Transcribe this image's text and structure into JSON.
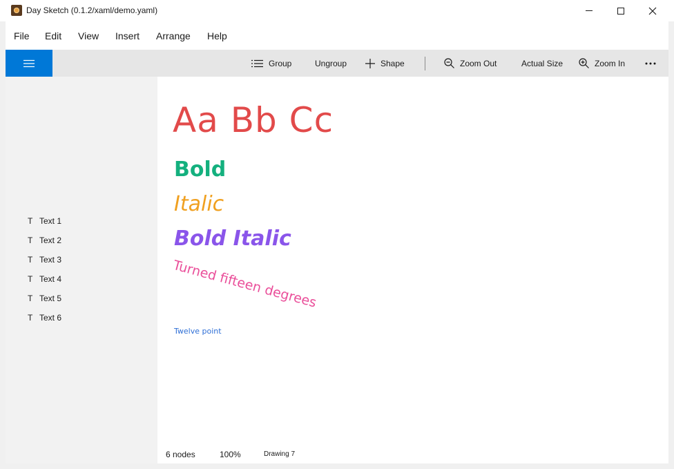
{
  "window": {
    "title": "Day Sketch (0.1.2/xaml/demo.yaml)",
    "controls": [
      "minimize",
      "maximize",
      "close"
    ]
  },
  "menu": {
    "items": [
      "File",
      "Edit",
      "View",
      "Insert",
      "Arrange",
      "Help"
    ]
  },
  "toolbar": {
    "group_label": "Group",
    "ungroup_label": "Ungroup",
    "shape_label": "Shape",
    "zoom_out_label": "Zoom Out",
    "actual_size_label": "Actual Size",
    "zoom_in_label": "Zoom In",
    "accent_color": "#0078d7"
  },
  "sidebar": {
    "nodes": [
      {
        "icon": "T",
        "label": "Text 1"
      },
      {
        "icon": "T",
        "label": "Text 2"
      },
      {
        "icon": "T",
        "label": "Text 3"
      },
      {
        "icon": "T",
        "label": "Text 4"
      },
      {
        "icon": "T",
        "label": "Text 5"
      },
      {
        "icon": "T",
        "label": "Text 6"
      }
    ]
  },
  "canvas": {
    "texts": [
      {
        "text": "Aa Bb Cc",
        "color": "#e24a4a"
      },
      {
        "text": "Bold",
        "color": "#14b07e"
      },
      {
        "text": "Italic",
        "color": "#f0a020"
      },
      {
        "text": "Bold Italic",
        "color": "#8a55ea"
      },
      {
        "text": "Turned fifteen degrees",
        "color": "#ea4f9a"
      },
      {
        "text": "Twelve point",
        "color": "#2f6fd6"
      }
    ]
  },
  "status": {
    "nodes": "6 nodes",
    "zoom": "100%",
    "drawing": "Drawing 7"
  }
}
